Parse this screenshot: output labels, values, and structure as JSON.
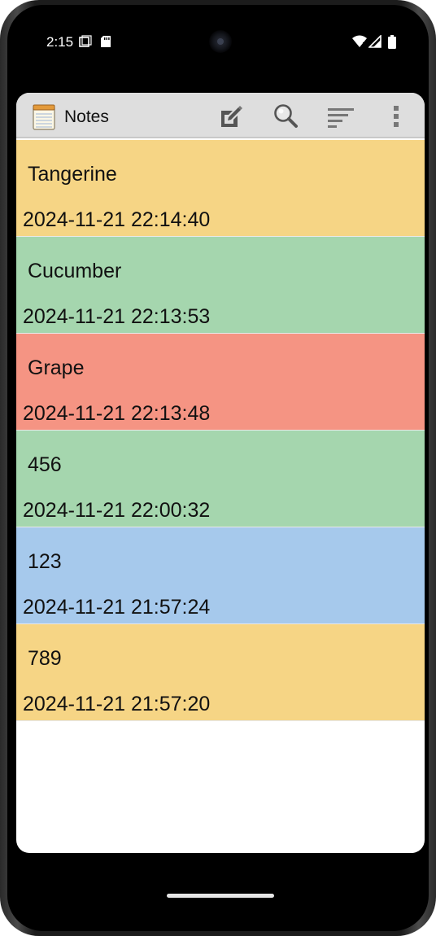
{
  "status_bar": {
    "time": "2:15",
    "icons": [
      "screen-record-icon",
      "sd-card-icon",
      "wifi-icon",
      "signal-icon",
      "battery-icon"
    ]
  },
  "app_bar": {
    "title": "Notes",
    "app_icon": "notepad-icon",
    "actions": [
      "new-note-icon",
      "search-icon",
      "sort-icon",
      "overflow-menu-icon"
    ]
  },
  "notes": [
    {
      "title": "Tangerine",
      "date": "2024-11-21 22:14:40",
      "color": "#f6d585"
    },
    {
      "title": "Cucumber",
      "date": "2024-11-21 22:13:53",
      "color": "#a5d6ae"
    },
    {
      "title": "Grape",
      "date": "2024-11-21 22:13:48",
      "color": "#f59483"
    },
    {
      "title": "456",
      "date": "2024-11-21 22:00:32",
      "color": "#a5d6ae"
    },
    {
      "title": "123",
      "date": "2024-11-21 21:57:24",
      "color": "#a6c9ec"
    },
    {
      "title": "789",
      "date": "2024-11-21 21:57:20",
      "color": "#f6d585"
    }
  ]
}
